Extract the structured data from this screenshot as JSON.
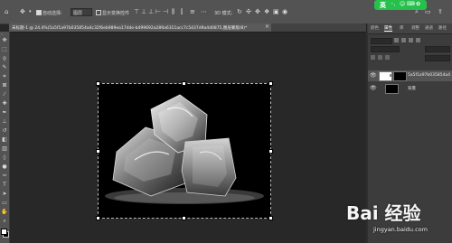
{
  "options_bar": {
    "move_icon": "move-tool-icon",
    "auto_select_label": "自动选择:",
    "auto_select_value": "图层",
    "show_transform_label": "显示变换控件",
    "mode_3d_label": "3D 模式:",
    "lang_badge": "英"
  },
  "document": {
    "tab_title": "未标题-1 @ 24.4%(5a5f1a97b035854a4c32f6eb989ea17dde-b499692a289a6311acc7c5437d9a4d0875,图层蒙版/8)*",
    "tab_close": "×",
    "zoom_level": "24.4%"
  },
  "panels": {
    "tabs": [
      {
        "label": "颜色",
        "active": false
      },
      {
        "label": "属性",
        "active": true
      },
      {
        "label": "库",
        "active": false
      },
      {
        "label": "调整",
        "active": false
      },
      {
        "label": "通道",
        "active": false
      },
      {
        "label": "路径",
        "active": false
      }
    ],
    "layers": [
      {
        "name": "5a5f1a97b035854a4",
        "visible": true,
        "has_mask": true
      },
      {
        "name": "背景",
        "visible": true,
        "has_mask": false
      }
    ]
  },
  "watermark": {
    "logo_text": "Bai 经验",
    "url": "jingyan.baidu.com"
  },
  "colors": {
    "canvas_bg": "#000000",
    "workspace_bg": "#282828",
    "chrome": "#535353",
    "lang_badge": "#27c04d"
  }
}
